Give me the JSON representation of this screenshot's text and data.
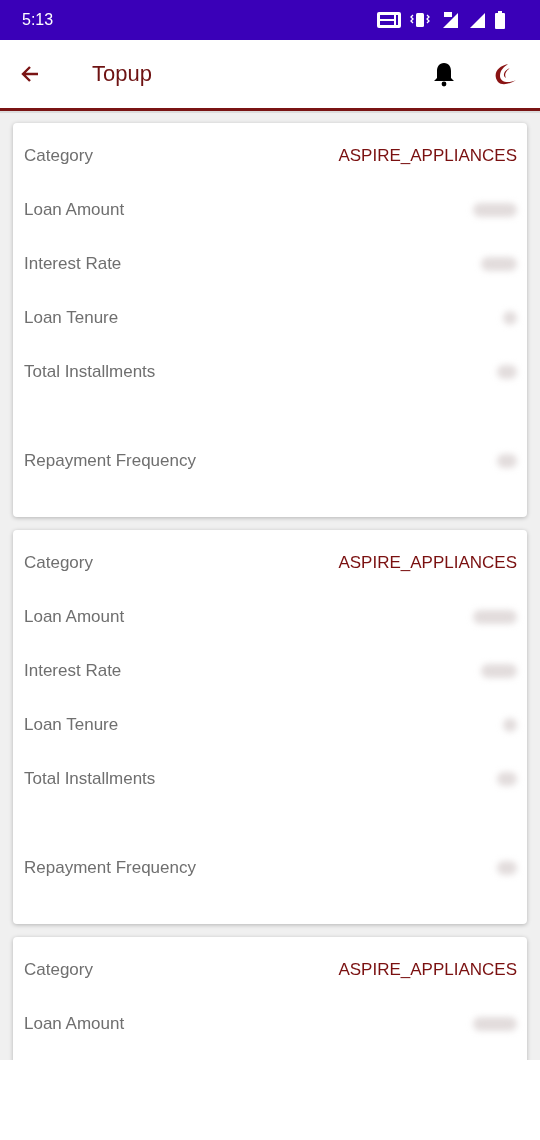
{
  "status_bar": {
    "time": "5:13"
  },
  "header": {
    "title": "Topup"
  },
  "cards": [
    {
      "rows": [
        {
          "label": "Category",
          "value": "ASPIRE_APPLIANCES",
          "redacted": false
        },
        {
          "label": "Loan Amount",
          "redacted": true
        },
        {
          "label": "Interest Rate",
          "redacted": true
        },
        {
          "label": "Loan Tenure",
          "redacted": true
        },
        {
          "label": "Total Installments",
          "redacted": true
        },
        {
          "label": "Repayment Frequency",
          "redacted": true
        }
      ]
    },
    {
      "rows": [
        {
          "label": "Category",
          "value": "ASPIRE_APPLIANCES",
          "redacted": false
        },
        {
          "label": "Loan Amount",
          "redacted": true
        },
        {
          "label": "Interest Rate",
          "redacted": true
        },
        {
          "label": "Loan Tenure",
          "redacted": true
        },
        {
          "label": "Total Installments",
          "redacted": true
        },
        {
          "label": "Repayment Frequency",
          "redacted": true
        }
      ]
    },
    {
      "rows": [
        {
          "label": "Category",
          "value": "ASPIRE_APPLIANCES",
          "redacted": false
        },
        {
          "label": "Loan Amount",
          "redacted": true
        }
      ]
    }
  ]
}
